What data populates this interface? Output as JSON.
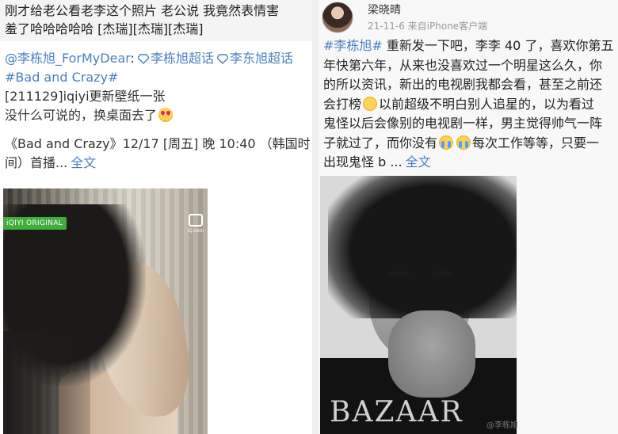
{
  "left": {
    "quote_lines": [
      "刚才给老公看老李这个照片 老公说 我竟然表情害",
      "羞了哈哈哈哈哈 [杰瑞][杰瑞][杰瑞]"
    ],
    "mention": "@李栋旭_ForMyDear",
    "colon": ":",
    "super_topic_1": "李栋旭超话",
    "super_topic_2": "李东旭超话",
    "hashtag": "#Bad and Crazy#",
    "update_line": "[211129]iqiyi更新壁纸一张",
    "comment_line": "没什么可说的，换桌面去了",
    "schedule_line_1": "《Bad and Crazy》12/17 [周五] 晚 10:40 （韩国时",
    "schedule_line_2": "间）首播...",
    "full_text": "全文",
    "photo_badge": "iQIYI ORIGINAL",
    "logo_sub": "iQ.com"
  },
  "right": {
    "username": "梁晓晴",
    "timestamp": "21-11-6",
    "source": "来自iPhone客户端",
    "lines": [
      [
        "#李栋旭#",
        " 重新发一下吧，李李 40 了，喜欢你第五"
      ],
      [
        "",
        "年快第六年，从来也没喜欢过一个明星这么久，你"
      ],
      [
        "",
        "的所以资讯，新出的电视剧我都会看，甚至之前还"
      ],
      [
        "",
        "会打榜"
      ]
    ],
    "line4_tail": "以前超级不明白别人追星的，以为看过",
    "line5": "鬼怪以后会像别的电视剧一样，男主觉得帅气一阵",
    "line6_head": "子就过了，而你没有",
    "line6_tail": "每次工作等等，只要一",
    "line7": "出现鬼怪 b ...",
    "full_text": "全文",
    "magazine": "BAZAAR",
    "watermark": "@李栋旭"
  },
  "colors": {
    "link": "#4a7fbf",
    "badge_green": "#3fae3a",
    "quote_bg": "#f4f4f4"
  },
  "icons": [
    "diamond-icon",
    "kiss-emoji-icon",
    "smile-emoji-icon",
    "crying-emoji-icon",
    "iqiyi-logo-icon",
    "avatar"
  ]
}
